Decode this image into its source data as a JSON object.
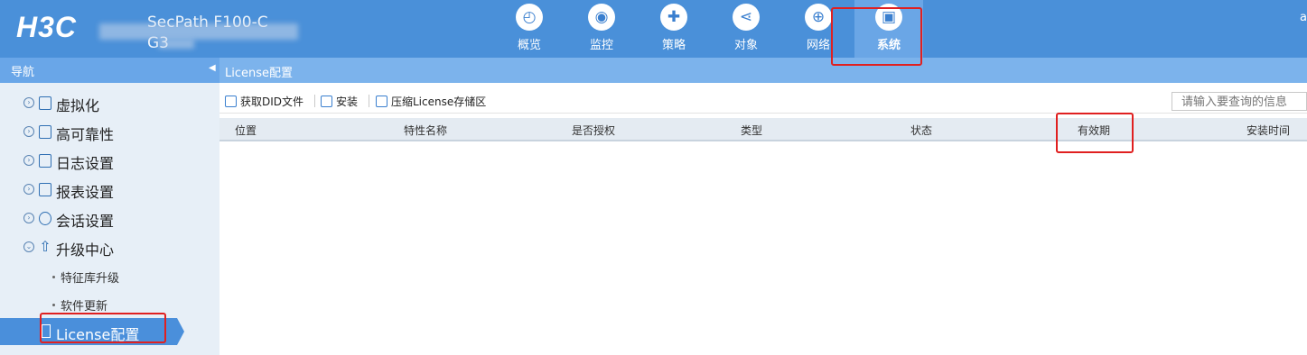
{
  "header": {
    "logo": "H3C",
    "device_name_line1": "SecPath F100-C",
    "device_name_line2": "G3",
    "user": "a",
    "nav": [
      {
        "label": "概览",
        "icon": "gauge-icon",
        "glyph": "◴"
      },
      {
        "label": "监控",
        "icon": "camera-icon",
        "glyph": "◉"
      },
      {
        "label": "策略",
        "icon": "shield-icon",
        "glyph": "✚"
      },
      {
        "label": "对象",
        "icon": "share-icon",
        "glyph": "⋖"
      },
      {
        "label": "网络",
        "icon": "globe-icon",
        "glyph": "⊕"
      },
      {
        "label": "系统",
        "icon": "monitor-icon",
        "glyph": "▣",
        "active": true
      }
    ]
  },
  "sidebar": {
    "title": "导航",
    "collapse_glyph": "◀",
    "menu": [
      {
        "label": "虚拟化"
      },
      {
        "label": "高可靠性"
      },
      {
        "label": "日志设置"
      },
      {
        "label": "报表设置"
      },
      {
        "label": "会话设置"
      },
      {
        "label": "升级中心",
        "expanded": true
      }
    ],
    "submenu": [
      "特征库升级",
      "软件更新"
    ],
    "active_item": "License配置"
  },
  "content": {
    "title": "License配置",
    "toolbar": {
      "get_did": "获取DID文件",
      "install": "安装",
      "compress": "压缩License存储区",
      "search_placeholder": "请输入要查询的信息"
    },
    "table": {
      "columns": [
        "位置",
        "特性名称",
        "是否授权",
        "类型",
        "状态",
        "有效期",
        "安装时间"
      ],
      "rows": []
    }
  },
  "colors": {
    "header_bg": "#4a90d9",
    "sidebar_bg": "#e7eff7",
    "active_item_bg": "#4a8fdb",
    "highlight": "#e02020"
  }
}
